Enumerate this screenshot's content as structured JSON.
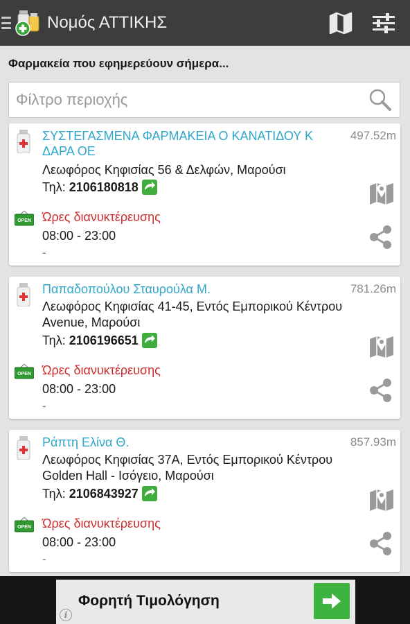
{
  "app": {
    "title": "Νομός ΑΤΤΙΚΗΣ"
  },
  "subtitle": "Φαρμακεία που εφημερεύουν σήμερα...",
  "filter": {
    "placeholder": "Φίλτρο περιοχής",
    "value": ""
  },
  "labels": {
    "phone_prefix": "Τηλ:",
    "hours_label": "Ώρες διανυκτέρευσης",
    "open_sign": "OPEN"
  },
  "pharmacies": [
    {
      "name": "ΣΥΣΤΕΓΑΣΜΕΝΑ ΦΑΡΜΑΚΕΙΑ Ο ΚΑΝΑΤΙΔΟΥ Κ ΔΑΡΑ ΟΕ",
      "distance": "497.52m",
      "address": "Λεωφόρος Κηφισίας 56 & Δελφών, Μαρούσι",
      "phone": "2106180818",
      "hours": "08:00 - 23:00",
      "extra": "-"
    },
    {
      "name": "Παπαδοπούλου Σταυρούλα Μ.",
      "distance": "781.26m",
      "address": "Λεωφόρος Κηφισίας 41-45, Εντός Εμπορικού Κέντρου Avenue, Μαρούσι",
      "phone": "2106196651",
      "hours": "08:00 - 23:00",
      "extra": "-"
    },
    {
      "name": "Ράπτη Ελίνα Θ.",
      "distance": "857.93m",
      "address": "Λεωφόρος Κηφισίας 37Α, Εντός Εμπορικού Κέντρου Golden Hall - Ισόγειο, Μαρούσι",
      "phone": "2106843927",
      "hours": "08:00 - 23:00",
      "extra": "-"
    }
  ],
  "ad": {
    "text": "Φορητή Τιμολόγηση",
    "info": "i"
  },
  "colors": {
    "actionbar": "#3d3d3d",
    "link": "#2fa6cc",
    "hours_label": "#cc2d2d",
    "ad_button": "#3fb33f"
  }
}
